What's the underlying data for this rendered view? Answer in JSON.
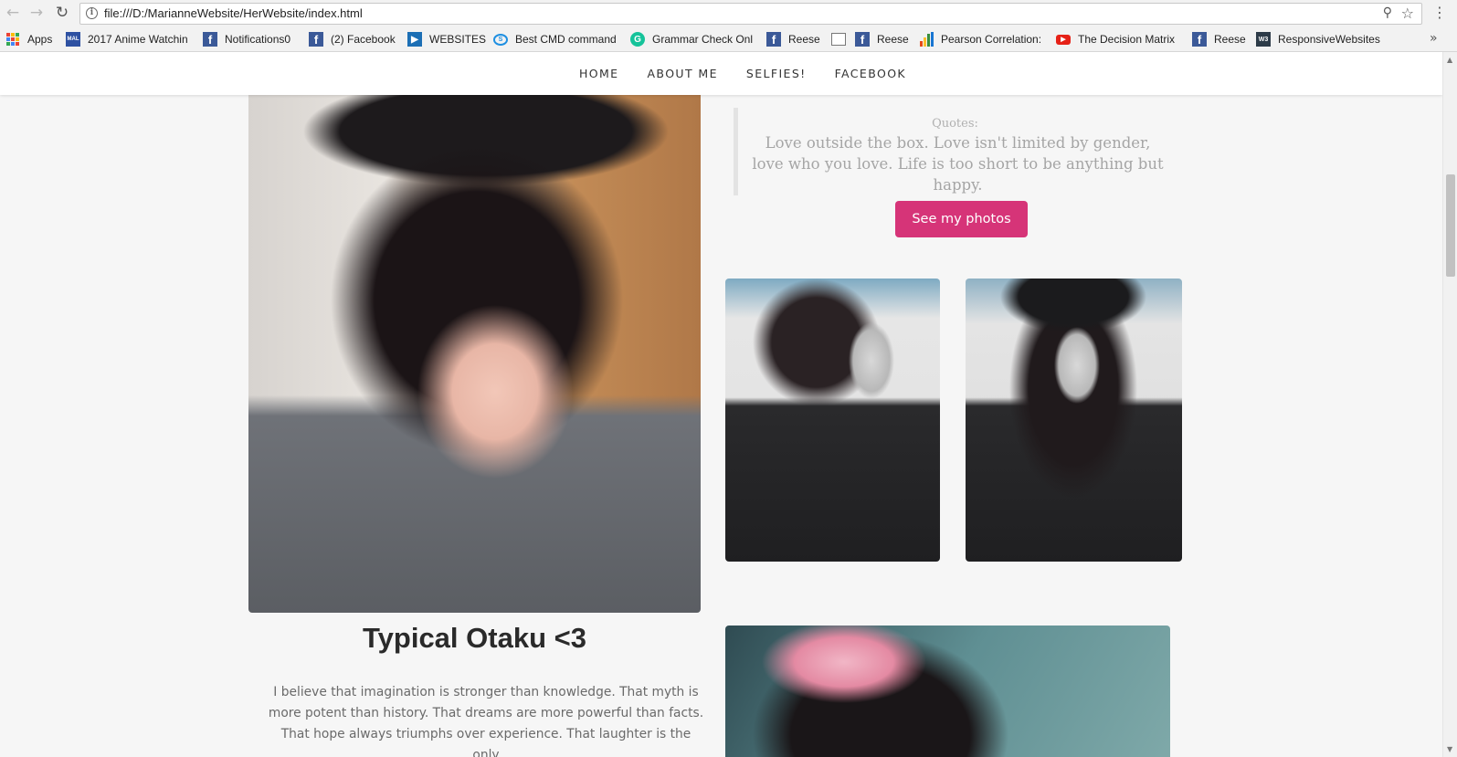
{
  "browser": {
    "url": "file:///D:/MarianneWebsite/HerWebsite/index.html",
    "nav": {
      "back": "←",
      "forward": "→",
      "reload": "↻"
    },
    "icons": {
      "info": "i",
      "zoom": "⚲",
      "star": "☆",
      "menu": "⋮",
      "more": "»"
    }
  },
  "bookmarks": [
    {
      "label": "Apps",
      "icon": "apps-grid-icon"
    },
    {
      "label": "2017 Anime Watchin",
      "icon": "myanimelist-icon"
    },
    {
      "label": "Notifications0",
      "icon": "facebook-icon"
    },
    {
      "label": "(2) Facebook",
      "icon": "facebook-icon"
    },
    {
      "label": "WEBSITES",
      "icon": "websites-icon"
    },
    {
      "label": "Best CMD command",
      "icon": "cmd-icon"
    },
    {
      "label": "Grammar Check Onl",
      "icon": "grammarly-icon"
    },
    {
      "label": "Reese",
      "icon": "facebook-icon"
    },
    {
      "label": "",
      "icon": "document-icon"
    },
    {
      "label": "Reese",
      "icon": "facebook-icon"
    },
    {
      "label": "Pearson Correlation:",
      "icon": "bar-chart-icon"
    },
    {
      "label": "The Decision Matrix",
      "icon": "youtube-icon"
    },
    {
      "label": "Reese",
      "icon": "facebook-icon"
    },
    {
      "label": "ResponsiveWebsites",
      "icon": "w3schools-icon"
    }
  ],
  "site_nav": {
    "items": [
      "HOME",
      "ABOUT ME",
      "SELFIES!",
      "FACEBOOK"
    ]
  },
  "quote": {
    "label": "Quotes:",
    "text": "Love outside the box. Love isn't limited by gender, love who you love. Life is too short to be anything but happy."
  },
  "cta": {
    "label": "See my photos"
  },
  "caption": {
    "title": "Typical Otaku <3",
    "text": "I believe that imagination is stronger than knowledge. That myth is more potent than history. That dreams are more powerful than facts. That hope always triumphs over experience. That laughter is the only"
  },
  "colors": {
    "accent": "#d63478",
    "page_bg": "#f6f6f6",
    "quote_text": "#a5a5a5"
  }
}
